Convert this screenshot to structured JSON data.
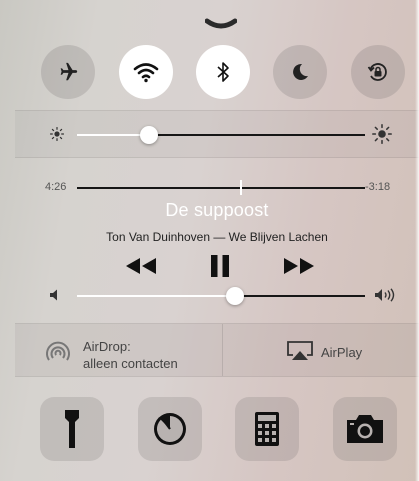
{
  "toggles": [
    {
      "icon": "airplane-icon",
      "on": false
    },
    {
      "icon": "wifi-icon",
      "on": true
    },
    {
      "icon": "bluetooth-icon",
      "on": true
    },
    {
      "icon": "moon-icon",
      "on": false
    },
    {
      "icon": "rotation-lock-icon",
      "on": false
    }
  ],
  "brightness": {
    "level": 0.25,
    "min_icon": "sun-small-icon",
    "max_icon": "sun-large-icon"
  },
  "music": {
    "elapsed": "4:26",
    "remaining": "-3:18",
    "progress": 0.57,
    "title": "De suppoost",
    "subtitle": "Ton Van Duinhoven — We Blijven Lachen",
    "controls": [
      "rewind-icon",
      "pause-icon",
      "fast-forward-icon"
    ]
  },
  "volume": {
    "level": 0.55,
    "min_icon": "speaker-low-icon",
    "max_icon": "speaker-high-icon"
  },
  "airdrop": {
    "line1": "AirDrop:",
    "line2": "alleen contacten"
  },
  "airplay": {
    "label": "AirPlay"
  },
  "tools": [
    "flashlight-icon",
    "timer-icon",
    "calculator-icon",
    "camera-icon"
  ],
  "colors": {
    "accent_on": "#ffffff",
    "track": "#161616"
  }
}
